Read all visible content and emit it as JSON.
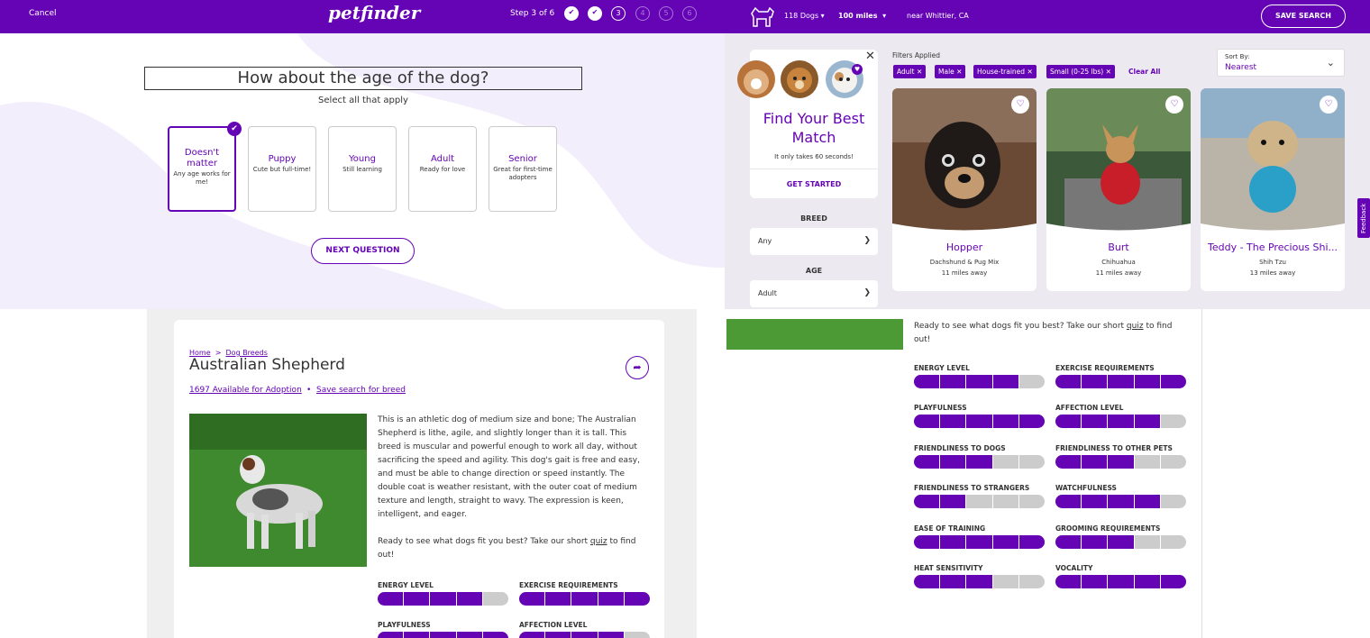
{
  "quiz": {
    "cancel": "Cancel",
    "logo": "petfinder",
    "step_text": "Step 3 of 6",
    "steps": [
      "1",
      "2",
      "3",
      "4",
      "5",
      "6"
    ],
    "question": "How about the age of the dog?",
    "subtitle": "Select all that apply",
    "options": [
      {
        "title": "Doesn't matter",
        "desc": "Any age works for me!",
        "selected": true
      },
      {
        "title": "Puppy",
        "desc": "Cute but full-time!",
        "selected": false
      },
      {
        "title": "Young",
        "desc": "Still learning",
        "selected": false
      },
      {
        "title": "Adult",
        "desc": "Ready for love",
        "selected": false
      },
      {
        "title": "Senior",
        "desc": "Great for first-time adopters",
        "selected": false
      }
    ],
    "next_button": "NEXT QUESTION"
  },
  "search": {
    "dogs": "118 Dogs",
    "distance": "100 miles",
    "location": "near Whittier, CA",
    "save_search": "SAVE SEARCH",
    "promo": {
      "title": "Find Your Best Match",
      "subtitle": "It only takes 60 seconds!",
      "button": "GET STARTED"
    },
    "breed_label": "BREED",
    "breed_value": "Any",
    "age_label": "AGE",
    "age_value": "Adult",
    "filters_label": "Filters Applied",
    "chips": [
      "Adult",
      "Male",
      "House-trained",
      "Small (0-25 lbs)"
    ],
    "clear_all": "Clear All",
    "sort_label": "Sort By:",
    "sort_value": "Nearest",
    "feedback": "Feedback",
    "cards": [
      {
        "name": "Hopper",
        "breed": "Dachshund & Pug Mix",
        "distance": "11 miles away"
      },
      {
        "name": "Burt",
        "breed": "Chihuahua",
        "distance": "11 miles away"
      },
      {
        "name": "Teddy - The Precious Shi...",
        "breed": "Shih Tzu",
        "distance": "13 miles away"
      }
    ]
  },
  "breed": {
    "crumb_home": "Home",
    "crumb_sep": ">",
    "crumb_breeds": "Dog Breeds",
    "title": "Australian Shepherd",
    "available": "1697 Available for Adoption",
    "dot": "•",
    "save_link": "Save search for breed",
    "description": "This is an athletic dog of medium size and bone; The Australian Shepherd is lithe, agile, and slightly longer than it is tall. This breed is muscular and powerful enough to work all day, without sacrificing the speed and agility. This dog's gait is free and easy, and must be able to change direction or speed instantly. The double coat is weather resistant, with the outer coat of medium texture and length, straight to wavy. The expression is keen, intelligent, and eager.",
    "ready_pre": "Ready to see what dogs fit you best? Take our short ",
    "quiz_link": "quiz",
    "ready_post": " to find out!",
    "traits": [
      {
        "label": "ENERGY LEVEL",
        "level": 4
      },
      {
        "label": "EXERCISE REQUIREMENTS",
        "level": 5
      },
      {
        "label": "PLAYFULNESS",
        "level": 5
      },
      {
        "label": "AFFECTION LEVEL",
        "level": 4
      },
      {
        "label": "FRIENDLINESS TO DOGS",
        "level": 3
      },
      {
        "label": "FRIENDLINESS TO OTHER PETS",
        "level": 3
      },
      {
        "label": "FRIENDLINESS TO STRANGERS",
        "level": 2
      },
      {
        "label": "WATCHFULNESS",
        "level": 4
      },
      {
        "label": "EASE OF TRAINING",
        "level": 5
      },
      {
        "label": "GROOMING REQUIREMENTS",
        "level": 3
      },
      {
        "label": "HEAT SENSITIVITY",
        "level": 3
      },
      {
        "label": "VOCALITY",
        "level": 5
      }
    ]
  },
  "colors": {
    "brand": "#6504b5",
    "bar_off": "#cccccc"
  }
}
